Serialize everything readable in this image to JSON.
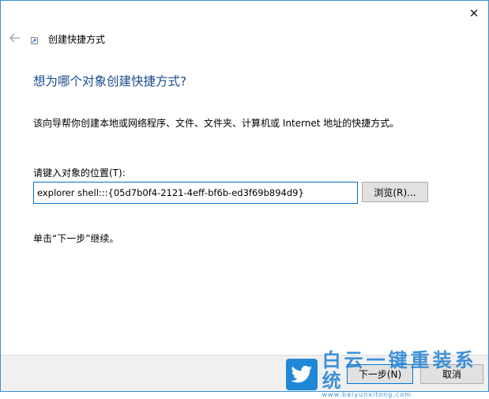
{
  "window": {
    "title": "创建快捷方式",
    "close_glyph": "✕"
  },
  "wizard": {
    "heading": "想为哪个对象创建快捷方式?",
    "description": "该向导帮你创建本地或网络程序、文件、文件夹、计算机或 Internet 地址的快捷方式。",
    "location_label": "请键入对象的位置(T):",
    "location_value": "explorer shell:::{05d7b0f4-2121-4eff-bf6b-ed3f69b894d9}",
    "browse_label": "浏览(R)...",
    "hint": "单击“下一步”继续。"
  },
  "footer": {
    "next_label": "下一步(N)",
    "cancel_label": "取消"
  },
  "watermark": {
    "title": "白云一键重装系统",
    "url": "www.baiyunxitong.com"
  },
  "icons": {
    "back": "back-arrow-icon",
    "shortcut": "shortcut-icon",
    "close": "close-icon",
    "watermark_logo": "twitter-bird-icon"
  },
  "colors": {
    "heading": "#1a4d8c",
    "accent": "#0078d7",
    "watermark": "#1f7fd3"
  }
}
